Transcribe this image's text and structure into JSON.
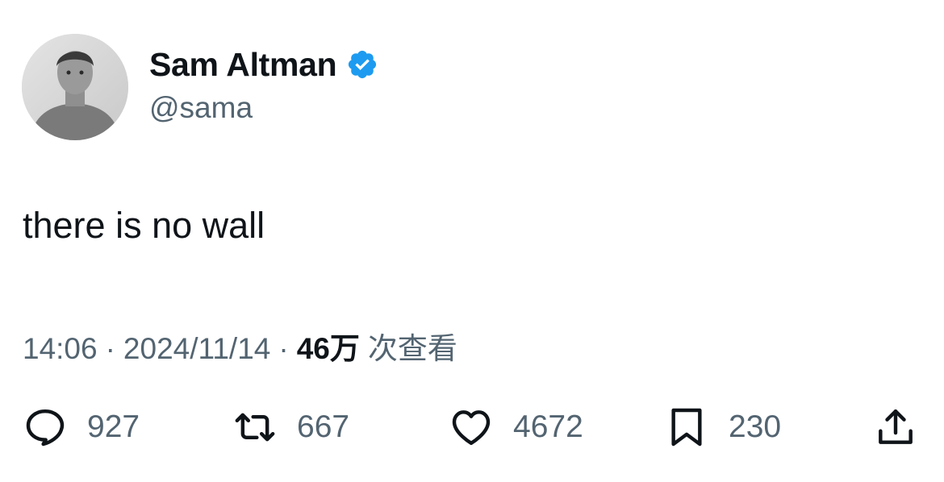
{
  "author": {
    "display_name": "Sam Altman",
    "handle": "@sama",
    "verified_color": "#1d9bf0"
  },
  "tweet": {
    "text": "there is no wall"
  },
  "meta": {
    "time": "14:06",
    "separator": "·",
    "date": "2024/11/14",
    "views_count": "46万",
    "views_label": "次查看"
  },
  "actions": {
    "reply": {
      "icon": "reply-icon",
      "count": "927"
    },
    "retweet": {
      "icon": "retweet-icon",
      "count": "667"
    },
    "like": {
      "icon": "heart-icon",
      "count": "4672"
    },
    "bookmark": {
      "icon": "bookmark-icon",
      "count": "230"
    },
    "share": {
      "icon": "share-icon"
    }
  },
  "colors": {
    "text_primary": "#0f1419",
    "text_secondary": "#536471"
  }
}
